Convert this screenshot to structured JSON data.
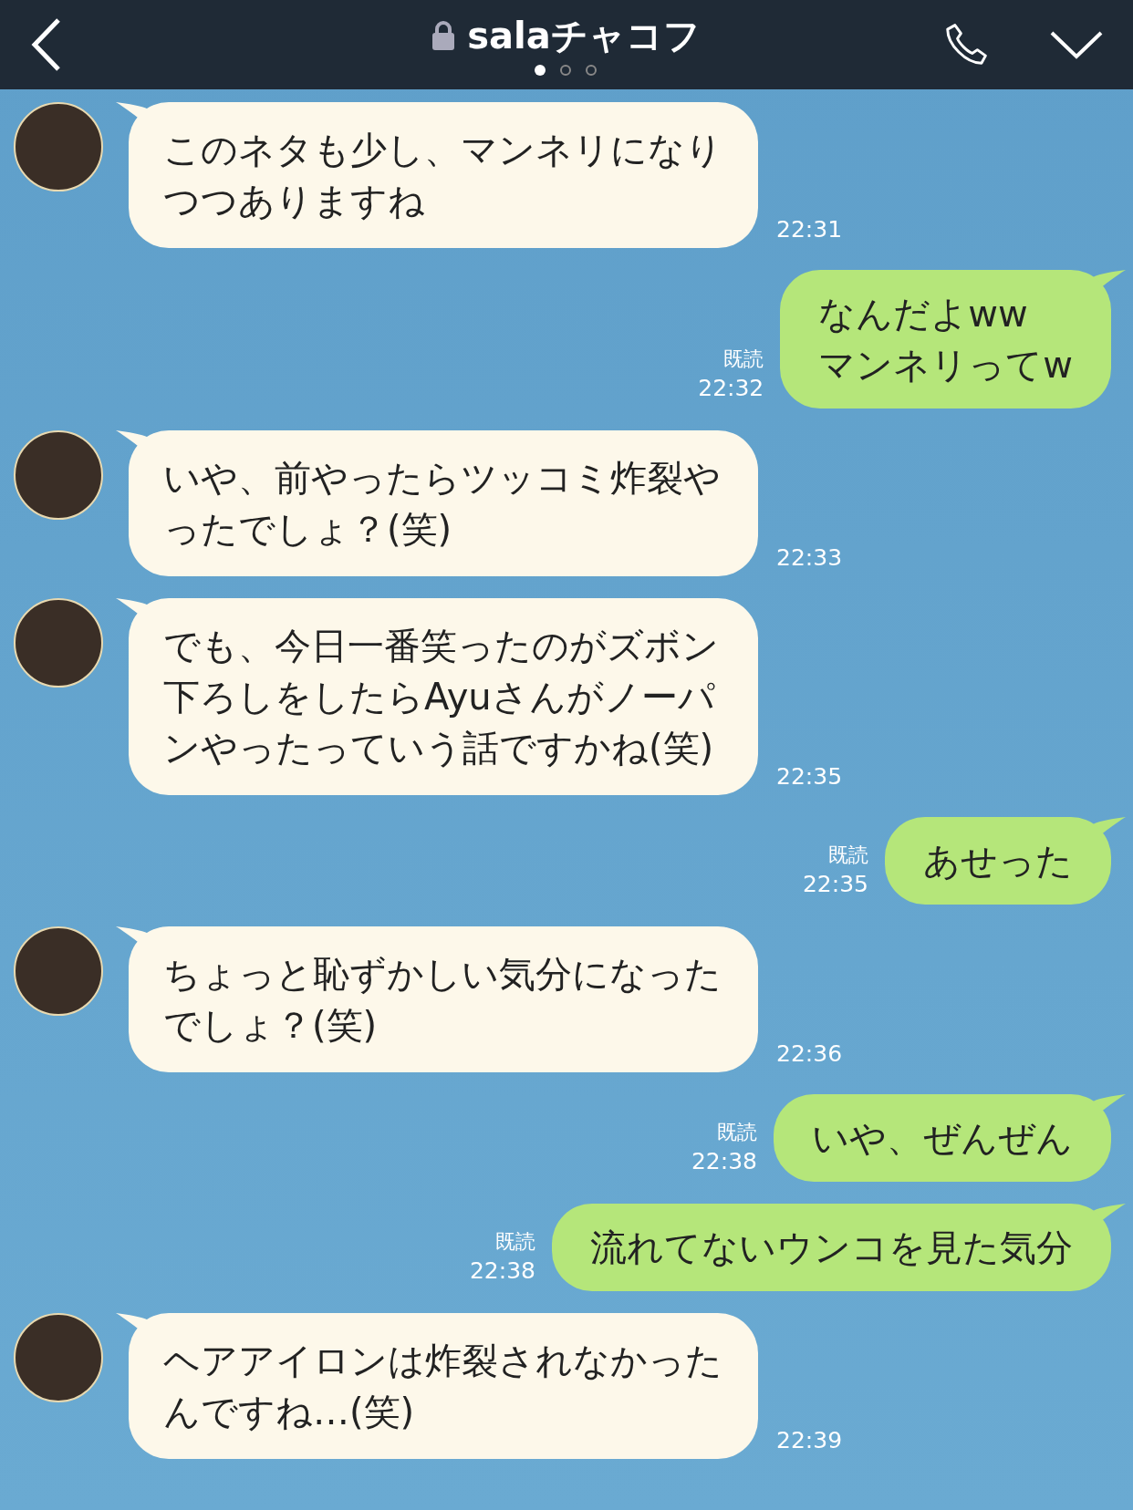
{
  "header": {
    "title": "salaチャコフ",
    "page_dots": [
      {
        "selected": true
      },
      {
        "selected": false
      },
      {
        "selected": false
      }
    ]
  },
  "messages": [
    {
      "kind": "incoming",
      "text": "このネタも少し、マンネリになりつつありますね",
      "time": "22:31"
    },
    {
      "kind": "outgoing",
      "text": "なんだよww\nマンネリってw",
      "read": "既読",
      "time": "22:32"
    },
    {
      "kind": "incoming",
      "text": "いや、前やったらツッコミ炸裂やったでしょ？(笑)",
      "time": "22:33"
    },
    {
      "kind": "incoming",
      "text": "でも、今日一番笑ったのがズボン下ろしをしたらAyuさんがノーパンやったっていう話ですかね(笑)",
      "time": "22:35"
    },
    {
      "kind": "outgoing",
      "text": "あせった",
      "read": "既読",
      "time": "22:35"
    },
    {
      "kind": "incoming",
      "text": "ちょっと恥ずかしい気分になったでしょ？(笑)",
      "time": "22:36"
    },
    {
      "kind": "outgoing",
      "text": "いや、ぜんぜん",
      "read": "既読",
      "time": "22:38"
    },
    {
      "kind": "outgoing",
      "text": "流れてないウンコを見た気分",
      "read": "既読",
      "time": "22:38"
    },
    {
      "kind": "incoming",
      "text": "ヘアアイロンは炸裂されなかったんですね…(笑)",
      "time": "22:39"
    }
  ]
}
